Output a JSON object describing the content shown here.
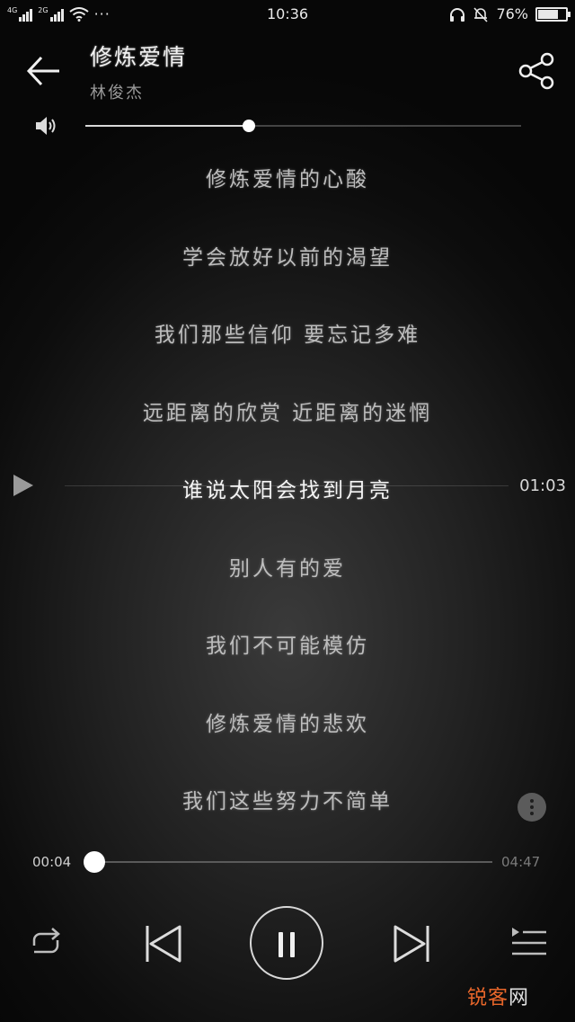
{
  "status_bar": {
    "time": "10:36",
    "battery_percent": "76%",
    "battery_level": 0.76,
    "sim1_tag": "4G",
    "sim2_tag": "2G",
    "more_dots": "···"
  },
  "header": {
    "title": "修炼爱情",
    "artist": "林俊杰"
  },
  "volume": {
    "level": 0.375
  },
  "lyrics": [
    {
      "text": "修炼爱情的心酸",
      "current": false
    },
    {
      "text": "学会放好以前的渴望",
      "current": false
    },
    {
      "text": "我们那些信仰 要忘记多难",
      "current": false
    },
    {
      "text": "远距离的欣赏 近距离的迷惘",
      "current": false
    },
    {
      "text": "谁说太阳会找到月亮",
      "current": true
    },
    {
      "text": "别人有的爱",
      "current": false
    },
    {
      "text": "我们不可能模仿",
      "current": false
    },
    {
      "text": "修炼爱情的悲欢",
      "current": false
    },
    {
      "text": "我们这些努力不简单",
      "current": false
    }
  ],
  "seek_preview": {
    "time": "01:03"
  },
  "playback": {
    "elapsed": "00:04",
    "total": "04:47",
    "progress": 0.021
  },
  "icons": {
    "back": "arrow-left-icon",
    "share": "share-icon",
    "volume": "speaker-icon",
    "play": "play-icon",
    "more": "more-vertical-icon",
    "repeat": "repeat-icon",
    "previous": "skip-previous-icon",
    "pause": "pause-icon",
    "next": "skip-next-icon",
    "playlist": "playlist-icon"
  },
  "watermark": {
    "part1": "锐客",
    "part2": "网"
  },
  "colors": {
    "accent": "#ffffff",
    "watermark": "#e8662a"
  }
}
